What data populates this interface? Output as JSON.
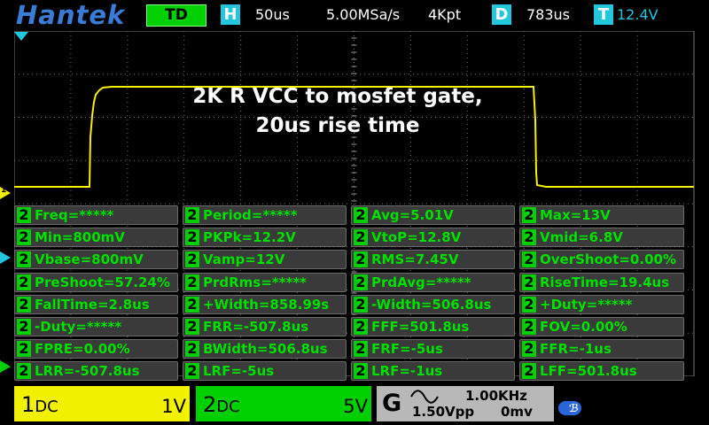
{
  "header": {
    "brand": "Hantek",
    "mode": "TD",
    "timebase_badge": "H",
    "timebase": "50us",
    "sample_rate": "5.00MSa/s",
    "memory_depth": "4Kpt",
    "delay_badge": "D",
    "delay": "783us",
    "trigger_badge": "T",
    "trigger_level": "12.4V"
  },
  "annotation": {
    "line1": "2K R VCC to mosfet gate,",
    "line2": "20us rise time"
  },
  "markers": {
    "ch1": "1",
    "ch2": "2",
    "trigger": "T"
  },
  "colors": {
    "ch1": "#f2f200",
    "ch2": "#00d000",
    "accent": "#22c6dd",
    "grid": "#6f6f6f"
  },
  "measurements": [
    [
      "Freq=*****",
      "Period=*****",
      "Avg=5.01V",
      "Max=13V"
    ],
    [
      "Min=800mV",
      "PKPk=12.2V",
      "VtoP=12.8V",
      "Vmid=6.8V"
    ],
    [
      "Vbase=800mV",
      "Vamp=12V",
      "RMS=7.45V",
      "OverShoot=0.00%"
    ],
    [
      "PreShoot=57.24%",
      "PrdRms=*****",
      "PrdAvg=*****",
      "RiseTime=19.4us"
    ],
    [
      "FallTime=2.8us",
      "+Width=858.99s",
      "-Width=506.8us",
      "+Duty=*****"
    ],
    [
      "-Duty=*****",
      "FRR=-507.8us",
      "FFF=501.8us",
      "FOV=0.00%"
    ],
    [
      "FPRE=0.00%",
      "BWidth=506.8us",
      "FRF=-5us",
      "FFR=-1us"
    ],
    [
      "LRR=-507.8us",
      "LRF=-5us",
      "LRF=-1us",
      "LFF=501.8us"
    ]
  ],
  "measurement_channel": "2",
  "channels": {
    "ch1": {
      "label": "1",
      "coupling": "DC",
      "scale": "1V"
    },
    "ch2": {
      "label": "2",
      "coupling": "DC",
      "scale": "5V"
    }
  },
  "generator": {
    "label": "G",
    "waveform": "sine",
    "frequency": "1.00KHz",
    "amplitude": "1.50Vpp",
    "offset": "0mv"
  },
  "status": {
    "bluetooth_icon": "bluetooth-icon"
  }
}
